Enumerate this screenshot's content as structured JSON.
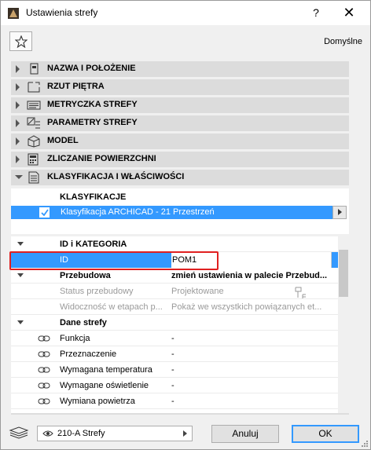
{
  "window": {
    "title": "Ustawienia strefy",
    "help_label": "?",
    "close_label": "✕"
  },
  "toolbar": {
    "default_label": "Domyślne"
  },
  "panels": [
    {
      "label": "NAZWA I POŁOŻENIE",
      "icon": "name-position-icon",
      "expanded": false
    },
    {
      "label": "RZUT PIĘTRA",
      "icon": "floor-plan-icon",
      "expanded": false
    },
    {
      "label": "METRYCZKA STREFY",
      "icon": "zone-stamp-icon",
      "expanded": false
    },
    {
      "label": "PARAMETRY STREFY",
      "icon": "zone-parameters-icon",
      "expanded": false
    },
    {
      "label": "MODEL",
      "icon": "model-icon",
      "expanded": false
    },
    {
      "label": "ZLICZANIE POWIERZCHNI",
      "icon": "area-calculation-icon",
      "expanded": false
    },
    {
      "label": "KLASYFIKACJA I WŁAŚCIWOŚCI",
      "icon": "classification-icon",
      "expanded": true
    }
  ],
  "classification": {
    "header": "KLASYFIKACJE",
    "row_label": "Klasyfikacja ARCHICAD - 21 Przestrzeń",
    "checked": true
  },
  "properties": {
    "group1": {
      "name": "ID i KATEGORIA"
    },
    "id_row": {
      "name": "ID",
      "value": "POM1"
    },
    "przebudowa": {
      "name": "Przebudowa",
      "value": "zmień ustawienia w palecie Przebud..."
    },
    "status": {
      "name": "Status przebudowy",
      "value": "Projektowane"
    },
    "widocznosc": {
      "name": "Widoczność w etapach p...",
      "value": "Pokaż we wszystkich powiązanych et..."
    },
    "group2": {
      "name": "Dane strefy"
    },
    "rows": [
      {
        "name": "Funkcja",
        "value": "-"
      },
      {
        "name": "Przeznaczenie",
        "value": "-"
      },
      {
        "name": "Wymagana temperatura",
        "value": "-"
      },
      {
        "name": "Wymagane oświetlenie",
        "value": "-"
      },
      {
        "name": "Wymiana powietrza",
        "value": "-"
      }
    ]
  },
  "footer": {
    "layer_value": "210-A Strefy",
    "cancel_label": "Anuluj",
    "ok_label": "OK"
  },
  "colors": {
    "selection": "#3399ff",
    "highlight_box": "#e02020",
    "panel_bg": "#dcdcdc"
  }
}
